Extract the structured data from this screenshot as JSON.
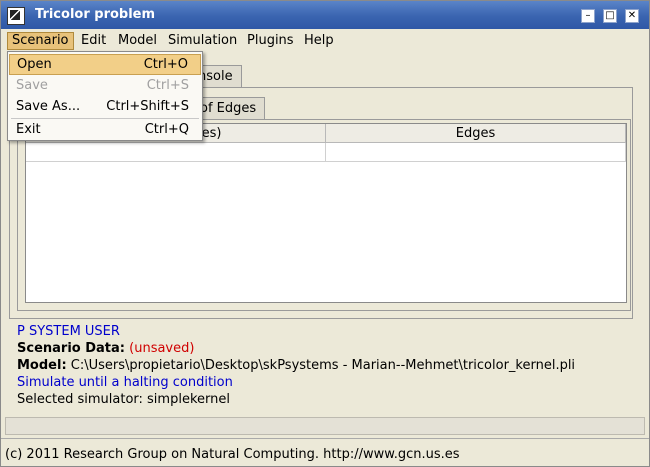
{
  "window": {
    "title": "Tricolor problem"
  },
  "menubar": [
    "Scenario",
    "Edit",
    "Model",
    "Simulation",
    "Plugins",
    "Help"
  ],
  "scenario_menu": {
    "items": [
      {
        "label": "Open",
        "shortcut": "Ctrl+O",
        "state": "highlighted"
      },
      {
        "label": "Save",
        "shortcut": "Ctrl+S",
        "state": "disabled"
      },
      {
        "label": "Save As...",
        "shortcut": "Ctrl+Shift+S",
        "state": "normal"
      },
      {
        "label": "Exit",
        "shortcut": "Ctrl+Q",
        "state": "normal"
      }
    ]
  },
  "tabs": {
    "outer_partial": "nsole",
    "inner_partial": "of Edges"
  },
  "table": {
    "columns": [
      "les)",
      "Edges"
    ]
  },
  "info": {
    "psystem": "P SYSTEM USER",
    "scenario_label": "Scenario Data:",
    "scenario_state": "(unsaved)",
    "model_label": "Model:",
    "model_path": "C:\\Users\\propietario\\Desktop\\skPsystems - Marian--Mehmet\\tricolor_kernel.pli",
    "simulate": "Simulate until a halting condition",
    "simulator": "Selected simulator: simplekernel"
  },
  "status": "(c) 2011 Research Group on Natural Computing. http://www.gcn.us.es",
  "colors": {
    "title_bar": "#3a64b0",
    "menu_highlight": "#f2cf88",
    "info_blue": "#0000cc",
    "info_red": "#d00000"
  }
}
